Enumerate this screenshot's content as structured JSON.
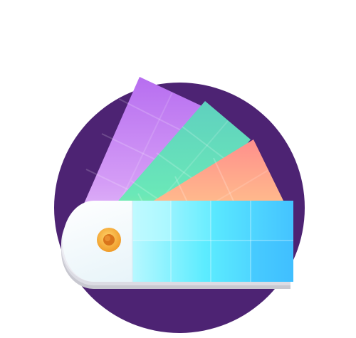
{
  "image": {
    "subject": "color-swatch-fan-icon",
    "colors": {
      "background": "#ffffff",
      "circle": "#4d2373",
      "card_body": "#eef8fc",
      "grommet_ring": "#f3a72e",
      "grommet_hole": "#d9741a"
    },
    "swatch_cards": [
      {
        "name": "purple",
        "colors": [
          "#b76ef0",
          "#c98bf3",
          "#d9a7f5",
          "#e7c6f8"
        ]
      },
      {
        "name": "teal-green",
        "colors": [
          "#63d7c3",
          "#5fe1bd",
          "#72eab0",
          "#9ef28f"
        ]
      },
      {
        "name": "orange-yellow",
        "colors": [
          "#ff9a8c",
          "#ffb188",
          "#ffd38e",
          "#fff6a0"
        ]
      },
      {
        "name": "cyan-blue",
        "colors": [
          "#4bc7ff",
          "#54dcff",
          "#5ee8ff",
          "#a8f4ff"
        ]
      }
    ]
  }
}
